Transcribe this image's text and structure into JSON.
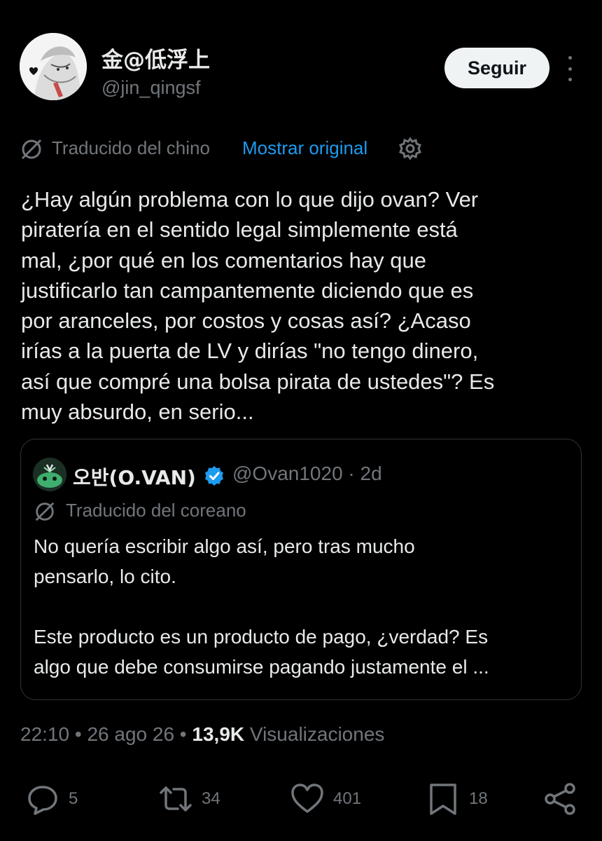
{
  "author": {
    "display_name": "金@低浮上",
    "handle": "@jin_qingsf",
    "follow_label": "Seguir"
  },
  "translation": {
    "label": "Traducido del chino",
    "show_original": "Mostrar original"
  },
  "tweet": {
    "text": "¿Hay algún problema con lo que dijo ovan? Ver\npiratería en el sentido legal simplemente está\nmal, ¿por qué en los comentarios hay que\njustificarlo tan campantemente diciendo que es\npor aranceles, por costos y cosas así? ¿Acaso\nirías a la puerta de LV y dirías \"no tengo dinero,\nasí que compré una bolsa pirata de ustedes\"? Es\nmuy absurdo, en serio..."
  },
  "quote": {
    "name": "오반(O.VAN)",
    "handle_time": "@Ovan1020 · 2d",
    "translated_label": "Traducido del coreano",
    "text": "No quería escribir algo así, pero tras mucho\npensarlo, lo cito.\n\nEste producto es un producto de pago, ¿verdad? Es\nalgo que debe consumirse pagando justamente el ..."
  },
  "meta": {
    "time": "22:10",
    "date": "26 ago 26",
    "views_count": "13,9K",
    "views_label": "Visualizaciones"
  },
  "actions": {
    "replies": "5",
    "reposts": "34",
    "likes": "401",
    "bookmarks": "18"
  },
  "colors": {
    "background": "#000000",
    "text": "#e7e9ea",
    "muted": "#71767b",
    "link": "#1d9bf0",
    "verified": "#1d9bf0",
    "border": "#2f3336"
  },
  "icons": {
    "translate": "translate-icon",
    "settings": "gear-icon",
    "verified": "verified-badge-icon",
    "reply": "reply-icon",
    "repost": "repost-icon",
    "like": "heart-icon",
    "bookmark": "bookmark-icon",
    "share": "share-icon",
    "more": "more-dots-icon"
  }
}
